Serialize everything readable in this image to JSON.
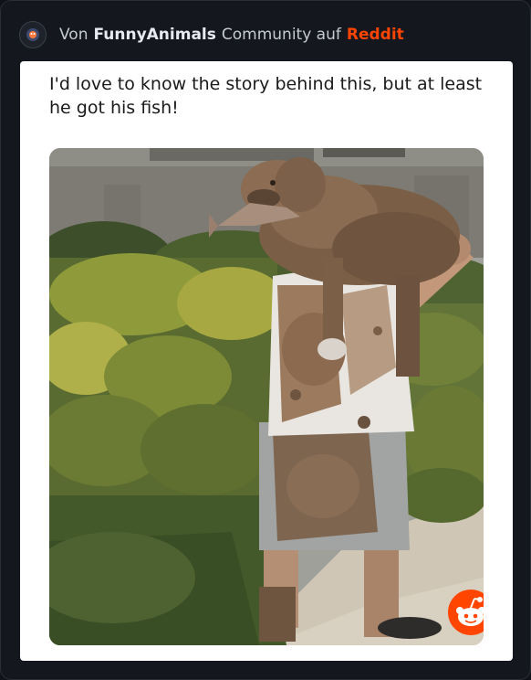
{
  "header": {
    "prefix": "Von",
    "community": "FunnyAnimals",
    "middle": "Community auf",
    "platform": "Reddit",
    "avatar_icon": "funnyanimals-avatar-icon"
  },
  "post": {
    "title_line1": "I'd love to know the story behind this, but at least",
    "title_line2": "he got his fish!",
    "media_description_icon": "photo-man-carrying-muddy-dog",
    "badge_icon": "reddit-logo-icon"
  },
  "colors": {
    "background": "#14171d",
    "community": "#e7eaee",
    "platform": "#ff4500",
    "card": "#ffffff"
  }
}
